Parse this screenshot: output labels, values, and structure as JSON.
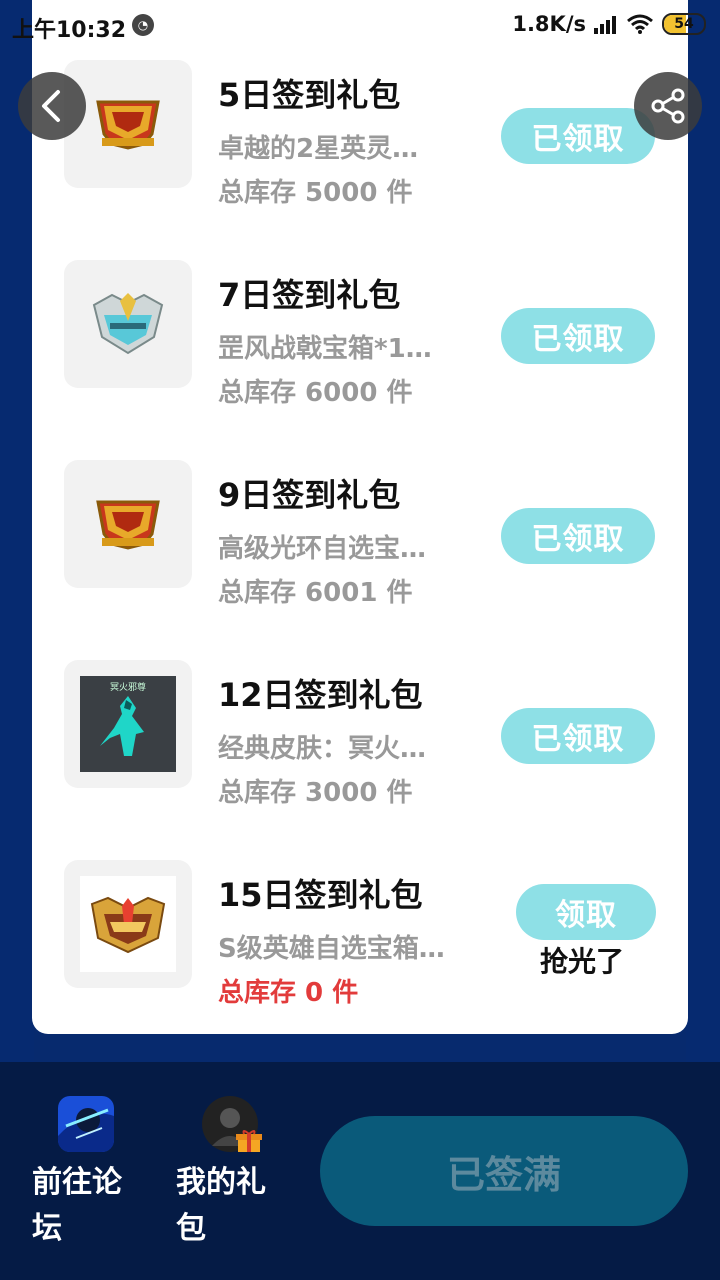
{
  "status_bar": {
    "time": "上午10:32",
    "net_speed": "1.8K/s",
    "battery": "54",
    "battery_level": 0.54
  },
  "gifts": [
    {
      "title": "5日签到礼包",
      "desc": "卓越的2星英灵…",
      "stock": "总库存 5000 件",
      "button": "已领取",
      "icon": "gold-helmet-icon"
    },
    {
      "title": "7日签到礼包",
      "desc": "罡风战戟宝箱*1…",
      "stock": "总库存 6000 件",
      "button": "已领取",
      "icon": "silver-helmet-icon"
    },
    {
      "title": "9日签到礼包",
      "desc": "高级光环自选宝…",
      "stock": "总库存 6001 件",
      "button": "已领取",
      "icon": "gold-helmet-icon"
    },
    {
      "title": "12日签到礼包",
      "desc": "经典皮肤：冥火…",
      "stock": "总库存 3000 件",
      "button": "已领取",
      "icon": "hero-skin-icon"
    },
    {
      "title": "15日签到礼包",
      "desc": "S级英雄自选宝箱…",
      "stock": "总库存 0 件",
      "button": "领取",
      "sold_out": "抢光了",
      "icon": "gold-crest-icon"
    }
  ],
  "skin_caption": "冥火邪尊",
  "bottom": {
    "forum_label": "前往论坛",
    "my_gifts_label": "我的礼包",
    "signed_full_label": "已签满"
  },
  "colors": {
    "background": "#072a6e",
    "button": "#8ee0e6",
    "bottom_bar": "#051b45",
    "stock_empty": "#e23b3b"
  }
}
